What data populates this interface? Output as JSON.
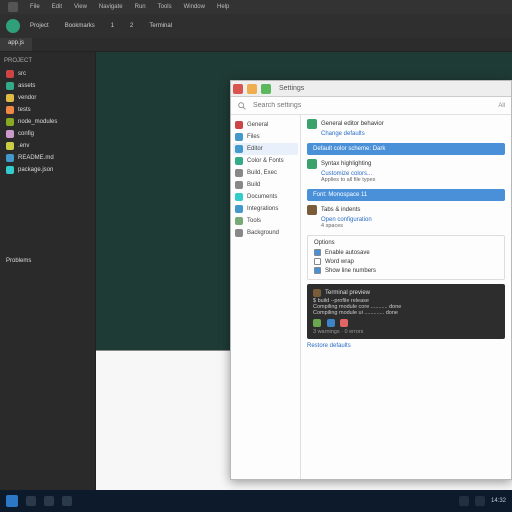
{
  "back": {
    "menubar": [
      "File",
      "Edit",
      "View",
      "Navigate",
      "Run",
      "Tools",
      "Window",
      "Help"
    ],
    "toolbar": {
      "avatar_color": "#2fa07a",
      "items": [
        "Project",
        "Bookmarks",
        "1",
        "2",
        "Terminal"
      ]
    },
    "tabs": [
      {
        "label": "app.js",
        "active": true
      }
    ],
    "sidebar": {
      "header": "PROJECT",
      "items": [
        {
          "label": "src",
          "color": "#c44"
        },
        {
          "label": "assets",
          "color": "#3a8"
        },
        {
          "label": "vendor",
          "color": "#db4"
        },
        {
          "label": "tests",
          "color": "#e84"
        },
        {
          "label": "node_modules",
          "color": "#8a2"
        },
        {
          "label": "config",
          "color": "#c9c"
        },
        {
          "label": ".env",
          "color": "#cc4"
        },
        {
          "label": "README.md",
          "color": "#49c"
        },
        {
          "label": "package.json",
          "color": "#3cc"
        }
      ]
    },
    "bottom_tab": "Problems"
  },
  "front": {
    "title": "Settings",
    "search": {
      "placeholder": "Search settings",
      "scope": "All"
    },
    "nav": [
      {
        "label": "General",
        "color": "#c44"
      },
      {
        "label": "Files",
        "color": "#49c"
      },
      {
        "label": "Editor",
        "color": "#49c",
        "active": true
      },
      {
        "label": "Color & Fonts",
        "color": "#3a8"
      },
      {
        "label": "Build, Exec",
        "color": "#888"
      },
      {
        "label": "Build",
        "color": "#888"
      },
      {
        "label": "Documents",
        "color": "#3cc"
      },
      {
        "label": "Integrations",
        "color": "#49c"
      },
      {
        "label": "Tools",
        "color": "#7a7"
      },
      {
        "label": "Background",
        "color": "#888"
      }
    ],
    "sections": [
      {
        "swatch": "#3aa26a",
        "title": "General editor behavior",
        "link": "Change defaults"
      },
      {
        "swatch": "#3aa26a",
        "title": "Syntax highlighting",
        "link": "Customize colors...",
        "sub": "Applies to all file types"
      },
      {
        "swatch": "#7a5b3a",
        "title": "Tabs & indents",
        "link": "Open configuration",
        "sub": "4 spaces"
      }
    ],
    "highlight_rows": [
      "Default color scheme: Dark",
      "Font: Monospace 11"
    ],
    "options_header": "Options",
    "options": [
      {
        "label": "Enable autosave",
        "checked": true
      },
      {
        "label": "Word wrap",
        "checked": false
      },
      {
        "label": "Show line numbers",
        "checked": true
      }
    ],
    "terminal": {
      "header_swatch": "#7a5b3a",
      "header": "Terminal preview",
      "lines": [
        "$ build --profile release",
        "Compiling module core ........... done",
        "Compiling module ui ............. done"
      ],
      "chips": [
        "#6aa84f",
        "#3d85c6",
        "#e06666"
      ],
      "footer": "3 warnings · 0 errors"
    },
    "link_footer": "Restore defaults"
  },
  "taskbar": {
    "clock": "14:32"
  }
}
